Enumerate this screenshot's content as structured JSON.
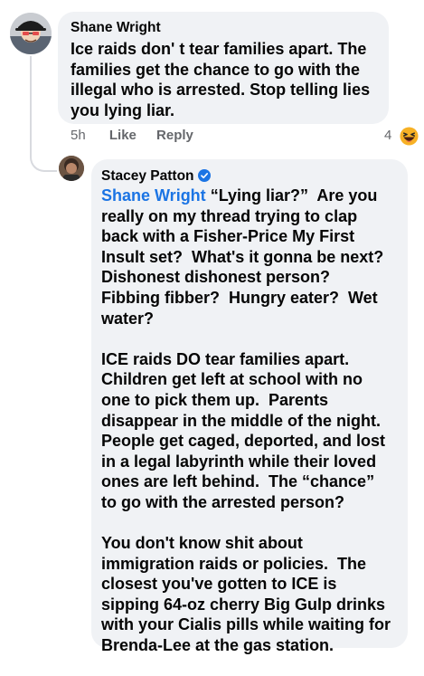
{
  "top_comment": {
    "author": "Shane Wright",
    "text": "Ice raids don' t tear families apart. The\nfamilies get the chance to go with the\nillegal who is arrested. Stop telling lies\nyou lying liar.",
    "time": "5h",
    "like_label": "Like",
    "reply_label": "Reply",
    "reaction_count": "4",
    "reaction_icon": "laughing-emoji-icon"
  },
  "reply_comment": {
    "author": "Stacey Patton",
    "verified_icon": "verified-badge-icon",
    "mention": "Shane Wright",
    "paragraph_1": " “Lying liar?”  Are you\nreally on my thread trying to clap\nback with a Fisher-Price My First\nInsult set?  What's it gonna be next?\nDishonest dishonest person?\nFibbing fibber?  Hungry eater?  Wet\nwater?",
    "paragraph_2": "ICE raids DO tear families apart.\nChildren get left at school with no\none to pick them up.  Parents\ndisappear in the middle of the night.\nPeople get caged, deported, and lost\nin a legal labyrinth while their loved\nones are left behind.  The “chance”\nto go with the arrested person?",
    "paragraph_3": "You don't know shit about\nimmigration raids or policies.  The\nclosest you've gotten to ICE is\nsipping 64-oz cherry Big Gulp drinks\nwith your Cialis pills while waiting for\nBrenda-Lee at the gas station."
  },
  "colors": {
    "bubble": "#f0f2f5",
    "text": "#050505",
    "secondary_text": "#65676b",
    "link": "#1b74e4",
    "verified": "#1b74e4",
    "thread_line": "#d8dadf"
  }
}
